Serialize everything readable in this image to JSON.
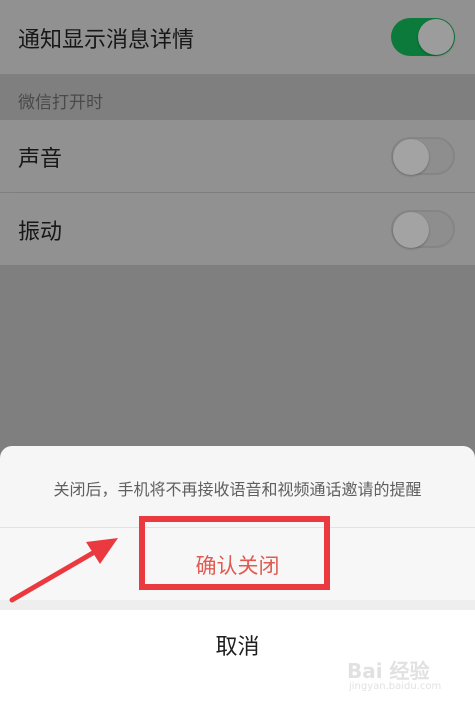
{
  "settings": {
    "notify_label": "通知显示消息详情",
    "section_header": "微信打开时",
    "sound_label": "声音",
    "vibrate_label": "振动",
    "notify_toggle": "on",
    "sound_toggle": "off",
    "vibrate_toggle": "off"
  },
  "sheet": {
    "message": "关闭后，手机将不再接收语音和视频通话邀请的提醒",
    "confirm_label": "确认关闭",
    "cancel_label": "取消"
  },
  "colors": {
    "toggle_on": "#0b7a3a",
    "confirm_text": "#e05b52",
    "annotation": "#ea3a40"
  },
  "watermark": {
    "logo": "Bai 经验",
    "sub": "jingyan.baidu.com"
  }
}
